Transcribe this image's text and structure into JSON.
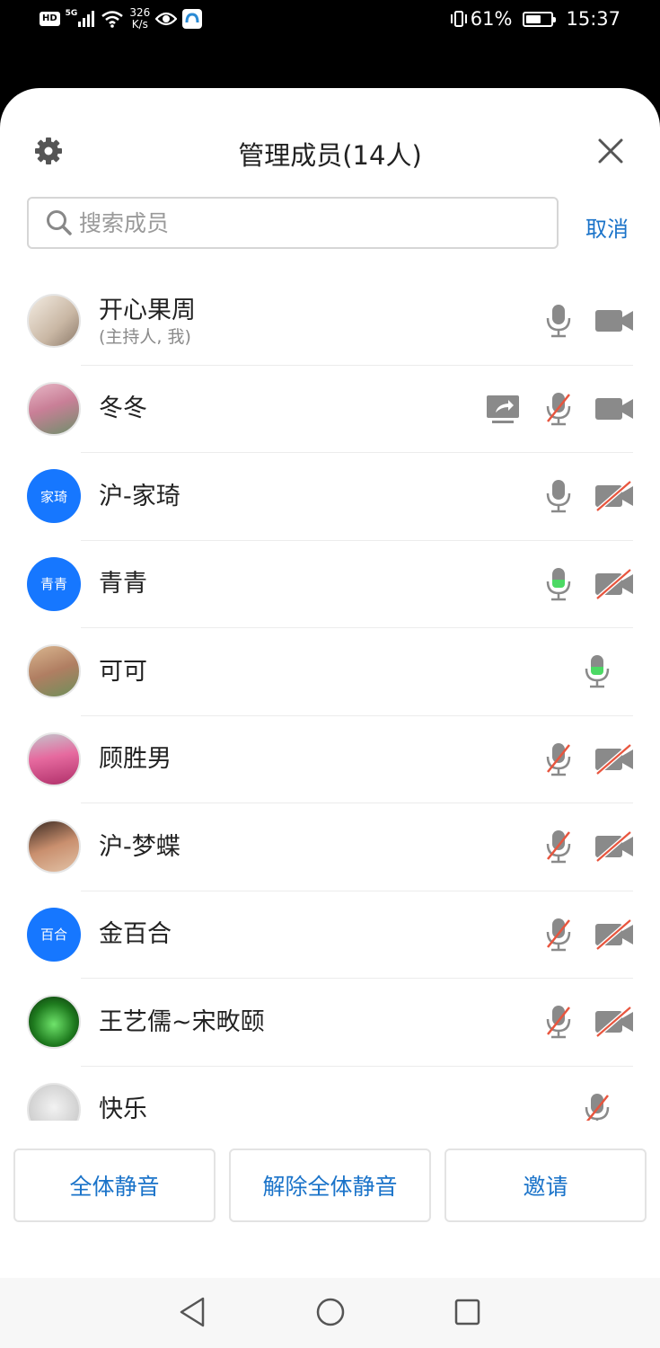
{
  "status_bar": {
    "hd": "HD",
    "network": "5G",
    "speed_value": "326",
    "speed_unit": "K/s",
    "battery": "61%",
    "battery_level": 0.61,
    "time": "15:37"
  },
  "header": {
    "title": "管理成员(14人)"
  },
  "search": {
    "placeholder": "搜索成员",
    "value": "",
    "cancel_label": "取消"
  },
  "members": [
    {
      "name": "开心果周",
      "sub": "(主持人, 我)",
      "avatar": "photo",
      "share": false,
      "mic": "on",
      "camera": "on"
    },
    {
      "name": "冬冬",
      "sub": "",
      "avatar": "photo",
      "share": true,
      "mic": "off",
      "camera": "on"
    },
    {
      "name": "沪-家琦",
      "sub": "",
      "avatar": "text",
      "avatar_text": "家琦",
      "share": false,
      "mic": "on",
      "camera": "off"
    },
    {
      "name": "青青",
      "sub": "",
      "avatar": "text",
      "avatar_text": "青青",
      "share": false,
      "mic": "speaking",
      "camera": "off"
    },
    {
      "name": "可可",
      "sub": "",
      "avatar": "photo",
      "share": false,
      "mic": "speaking",
      "camera": "none"
    },
    {
      "name": "顾胜男",
      "sub": "",
      "avatar": "photo",
      "share": false,
      "mic": "off",
      "camera": "off"
    },
    {
      "name": "沪-梦蝶",
      "sub": "",
      "avatar": "photo",
      "share": false,
      "mic": "off",
      "camera": "off"
    },
    {
      "name": "金百合",
      "sub": "",
      "avatar": "text",
      "avatar_text": "百合",
      "share": false,
      "mic": "off",
      "camera": "off"
    },
    {
      "name": "王艺儒~宋畋颐",
      "sub": "",
      "avatar": "photo",
      "share": false,
      "mic": "off",
      "camera": "off"
    },
    {
      "name": "快乐",
      "sub": "",
      "avatar": "photo",
      "share": false,
      "mic": "off",
      "camera": "none"
    }
  ],
  "buttons": {
    "mute_all": "全体静音",
    "unmute_all": "解除全体静音",
    "invite": "邀请"
  },
  "colors": {
    "accent": "#1a73c9",
    "avatar_blue": "#1677ff",
    "speaking_green": "#4cd964",
    "muted_red": "#e8553e",
    "icon_gray": "#8a8a8a"
  }
}
